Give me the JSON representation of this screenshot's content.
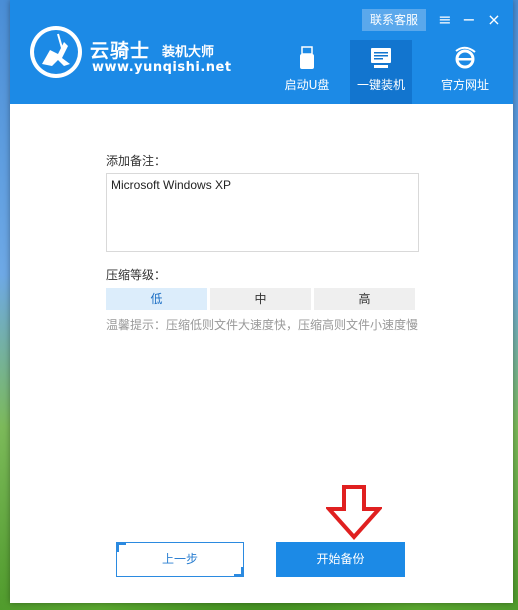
{
  "header": {
    "brand": "云骑士",
    "brand_sub": "装机大师",
    "url": "www.yunqishi.net",
    "contact": "联系客服"
  },
  "nav": [
    {
      "label": "启动U盘",
      "icon": "usb-drive-icon"
    },
    {
      "label": "一键装机",
      "icon": "computer-icon",
      "active": true
    },
    {
      "label": "官方网址",
      "icon": "ie-browser-icon"
    }
  ],
  "form": {
    "note_label": "添加备注：",
    "note_value": "Microsoft Windows XP",
    "compress_label": "压缩等级：",
    "levels": [
      {
        "label": "低",
        "active": true
      },
      {
        "label": "中",
        "active": false
      },
      {
        "label": "高",
        "active": false
      }
    ],
    "hint": "温馨提示：压缩低则文件大速度快，压缩高则文件小速度慢"
  },
  "actions": {
    "prev": "上一步",
    "start": "开始备份"
  },
  "colors": {
    "header": "#1c8ae6",
    "nav_active": "#1275cf",
    "arrow": "#e02020"
  }
}
